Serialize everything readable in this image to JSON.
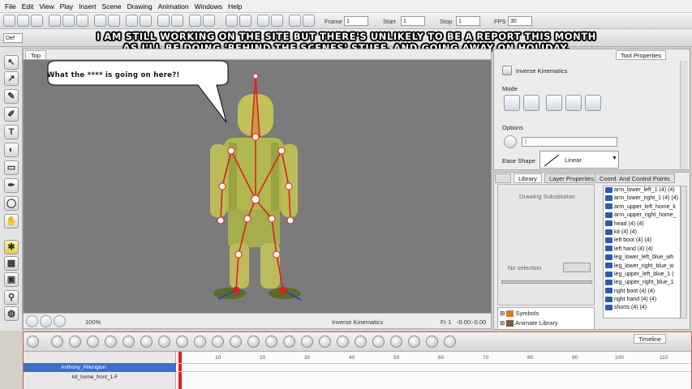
{
  "menu": [
    "File",
    "Edit",
    "View",
    "Play",
    "Insert",
    "Scene",
    "Drawing",
    "Animation",
    "Windows",
    "Help"
  ],
  "toolbar": {
    "frame_label": "Frame",
    "frame_value": "1",
    "start_label": "Start",
    "start_value": "1",
    "stop_label": "Stop",
    "stop_value": "1",
    "fps_label": "FPS",
    "fps_value": "30",
    "drawing_field": "Def"
  },
  "caption": {
    "line1": "I am still working on the site but there's unlikely to be a report this month",
    "line2": "as I'll be doing 'behind the scenes' stuff. and going away on holiday."
  },
  "speech_bubble": "What the **** is going on here?!",
  "camera_view": {
    "tab": "Top",
    "zoom": "100%",
    "mode": "Inverse Kinematics",
    "frame": "Fr 1",
    "coords": "-0.00:-0.00"
  },
  "tool_properties": {
    "tab": "Tool Properties",
    "title": "Inverse Kinematics",
    "mode_label": "Mode",
    "options_label": "Options",
    "options_value": "1",
    "ease_shape_label": "Ease Shape",
    "ease_shape_value": "Linear"
  },
  "library": {
    "tabs": [
      "Library",
      "Layer Properties",
      "Coord. And Control Points"
    ],
    "drawing_substitution": "Drawing Substitution",
    "no_selection": "No selection",
    "items": [
      "arm_lower_left_1 (4) (4)",
      "arm_lower_right_1 (4) (4)",
      "arm_upper_left_home_k",
      "arm_upper_right_home_",
      "head (4) (4)",
      "kit (4) (4)",
      "left boot (4) (4)",
      "left hand (4) (4)",
      "leg_lower_left_blue_wh",
      "leg_lower_right_blue_w",
      "leg_upper_left_blue_1 (",
      "leg_upper_right_blue_1",
      "right boot (4) (4)",
      "right hand (4) (4)",
      "shorts (4) (4)"
    ],
    "tree": [
      "Symbols",
      "Animate Library"
    ]
  },
  "timeline": {
    "tab": "Timeline",
    "ruler": [
      "10",
      "20",
      "30",
      "40",
      "50",
      "60",
      "70",
      "80",
      "90",
      "100",
      "110"
    ],
    "layers": [
      "Anthony_Pilkington",
      "kit_home_front_1-F"
    ]
  },
  "colors": {
    "viewport_bg": "#7b7b7b",
    "bone": "#e02020",
    "figure": "#b8c24a",
    "selected_layer": "#3a6fd0",
    "playhead": "#e02020"
  }
}
